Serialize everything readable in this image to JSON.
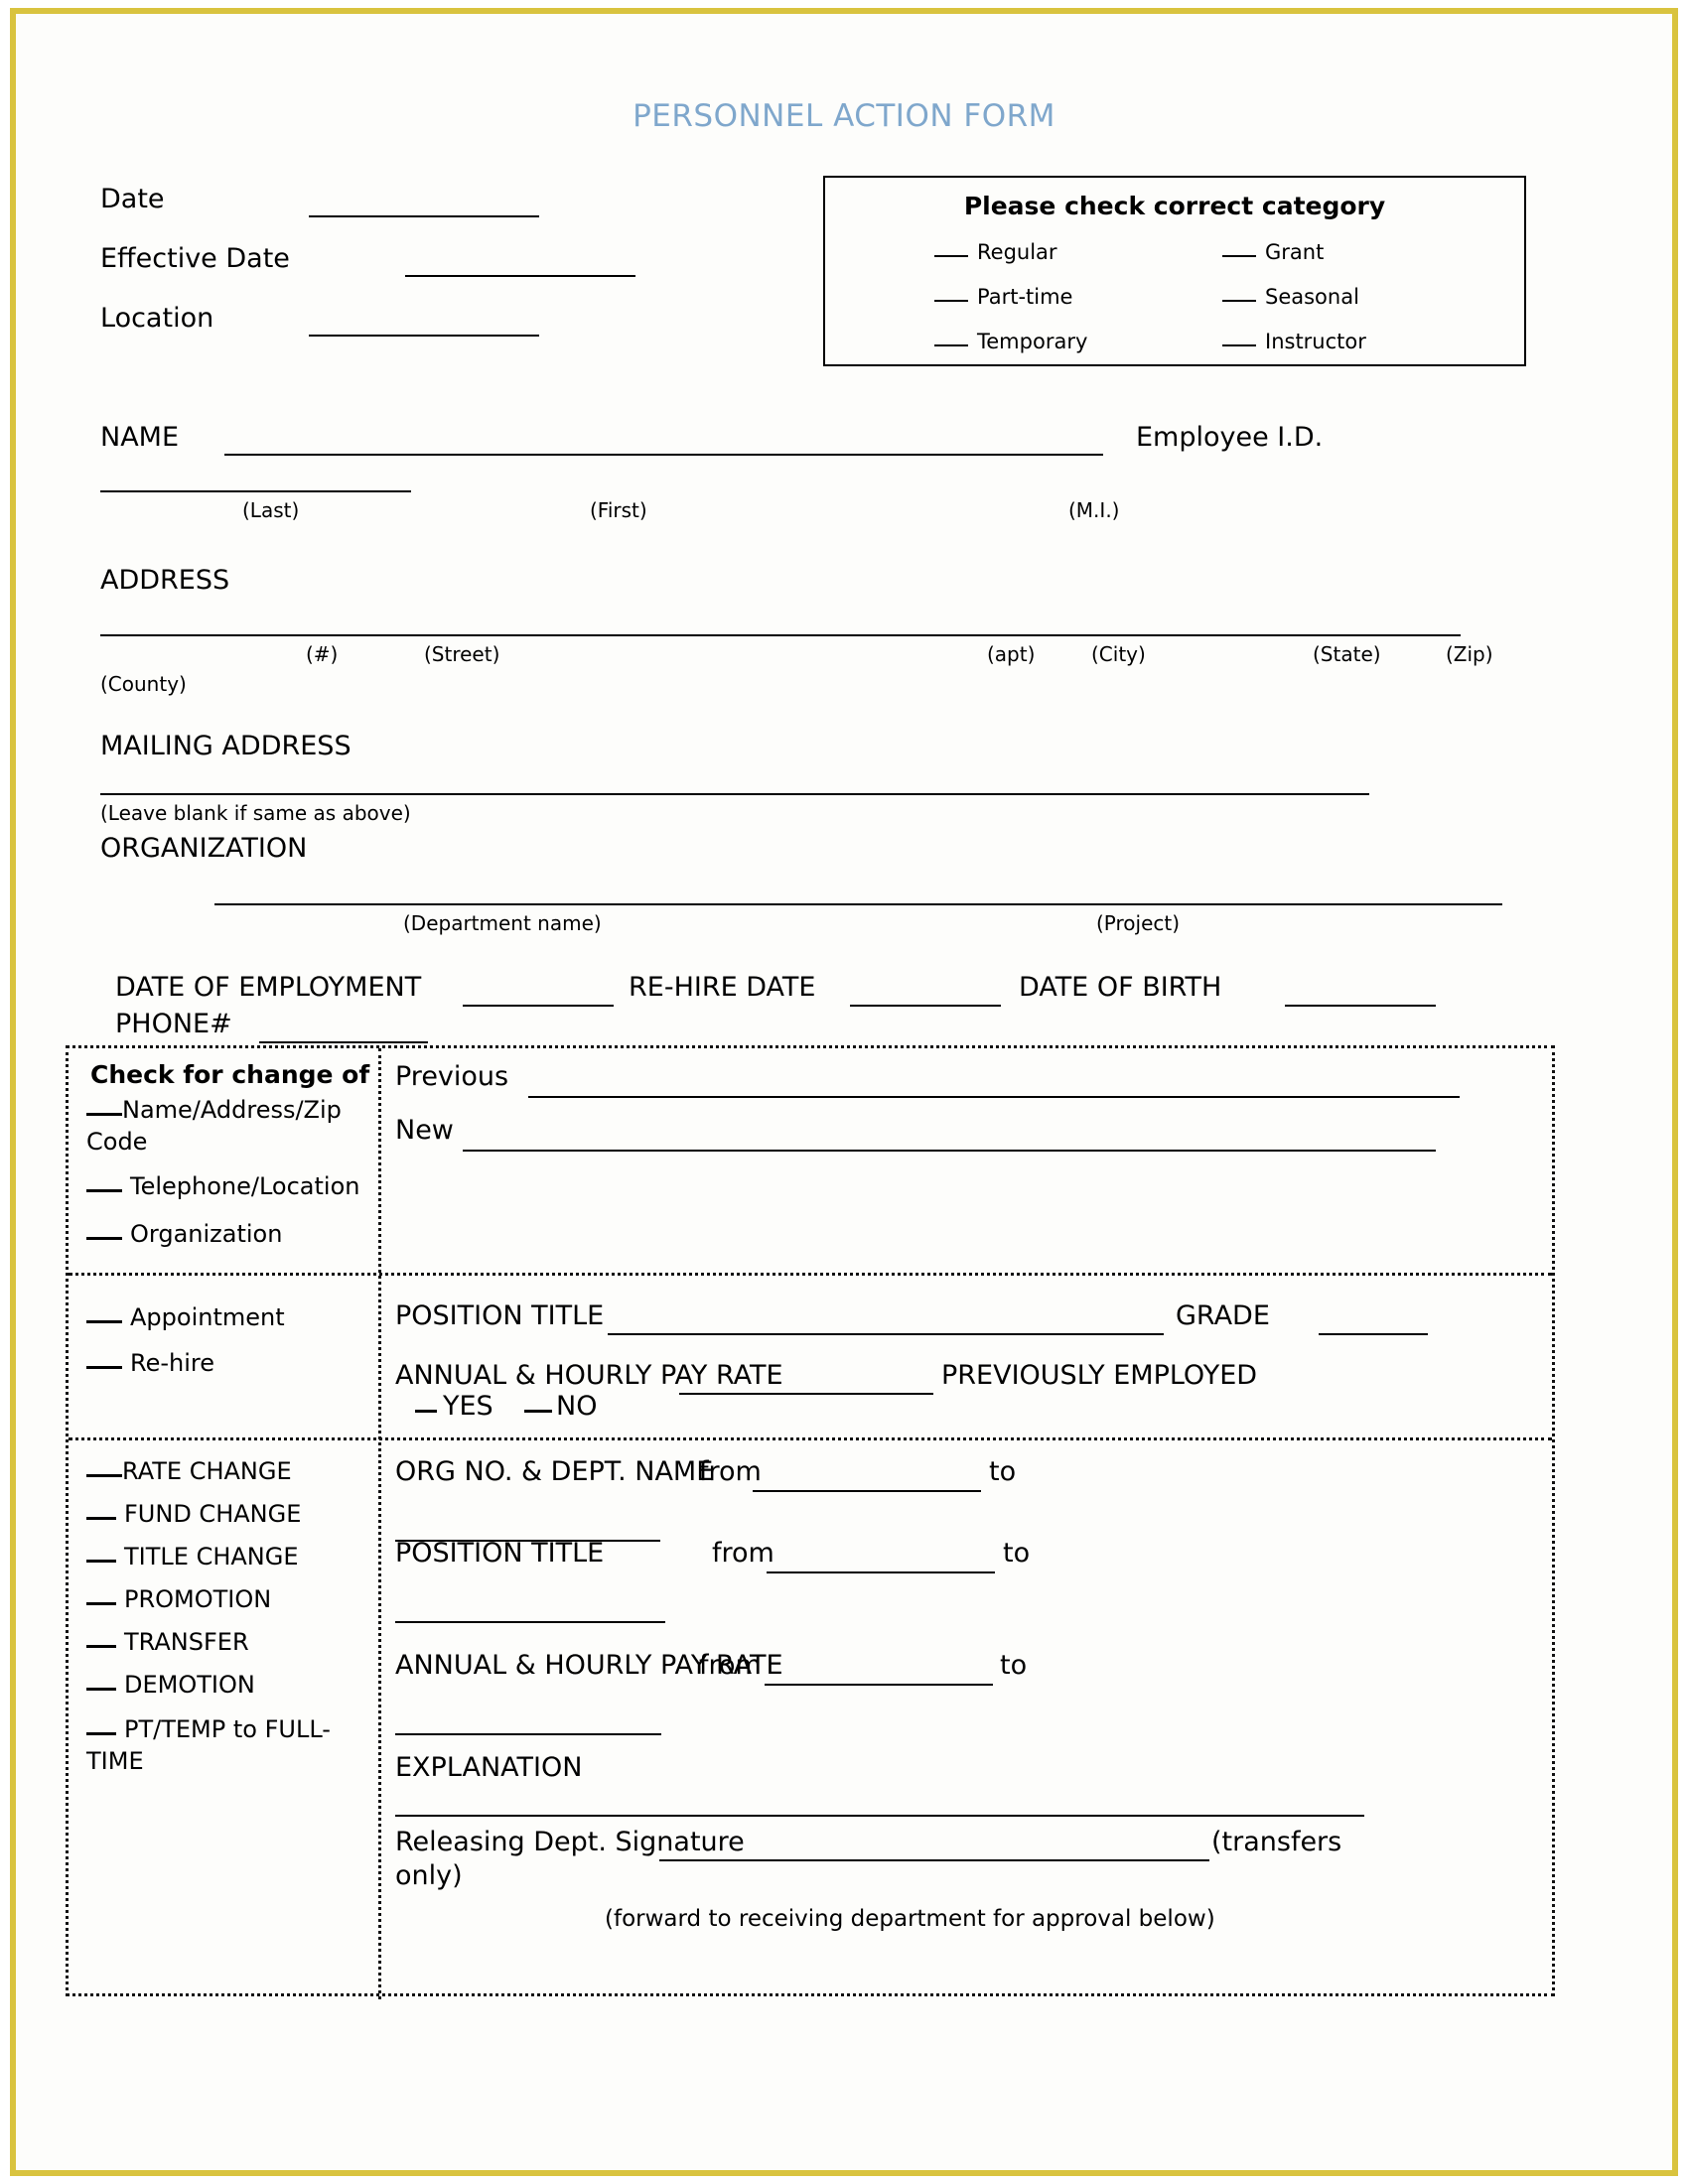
{
  "page": {
    "title": "PERSONNEL ACTION FORM",
    "title_color": "#7fa7cc",
    "frame_color": "#d9c33f"
  },
  "header": {
    "date_label": "Date",
    "effective_date_label": "Effective Date",
    "location_label": "Location"
  },
  "category_box": {
    "heading": "Please check correct category",
    "left_items": [
      "Regular",
      "Part-time",
      "Temporary"
    ],
    "right_items": [
      "Grant",
      "Seasonal",
      "Instructor"
    ]
  },
  "identity": {
    "name_label": "NAME",
    "employee_id_label": "Employee I.D.",
    "name_subs": [
      "(Last)",
      "(First)",
      "(M.I.)"
    ]
  },
  "address": {
    "label": "ADDRESS",
    "subs": [
      "(#)",
      "(Street)",
      "(apt)",
      "(City)",
      "(State)",
      "(Zip)"
    ],
    "county": "(County)",
    "mailing_label": "MAILING ADDRESS",
    "mailing_note": "(Leave blank if same as above)"
  },
  "organization": {
    "label": "ORGANIZATION",
    "dept_sub": "(Department name)",
    "project_sub": "(Project)"
  },
  "employment": {
    "date_of_employment": "DATE OF EMPLOYMENT",
    "rehire_date": "RE-HIRE DATE",
    "date_of_birth": "DATE OF BIRTH",
    "phone": "PHONE#"
  },
  "change_section": {
    "heading": "Check for change of",
    "items": [
      "Name/Address/Zip Code",
      "Telephone/Location",
      "Organization"
    ],
    "previous_label": "Previous",
    "new_label": "New"
  },
  "appointment_section": {
    "items": [
      "Appointment",
      "Re-hire"
    ],
    "position_title_label": "POSITION TITLE",
    "grade_label": "GRADE",
    "pay_rate_label": "ANNUAL & HOURLY PAY RATE",
    "previously_employed_label": "PREVIOUSLY EMPLOYED",
    "yes_label": "YES",
    "no_label": "NO"
  },
  "action_section": {
    "items": [
      "RATE CHANGE",
      "FUND CHANGE",
      "TITLE CHANGE",
      "PROMOTION",
      "TRANSFER",
      "DEMOTION",
      "PT/TEMP to FULL-TIME"
    ],
    "org_no_label": "ORG NO. & DEPT. NAME",
    "position_title_label": "POSITION TITLE",
    "pay_rate_label": "ANNUAL & HOURLY PAY RATE",
    "from_label": "from",
    "to_label": "to",
    "explanation_label": "EXPLANATION",
    "releasing_signature_label": "Releasing Dept. Signature",
    "transfers_only_label": "(transfers only)",
    "forward_note": "(forward to receiving department for approval below)"
  }
}
